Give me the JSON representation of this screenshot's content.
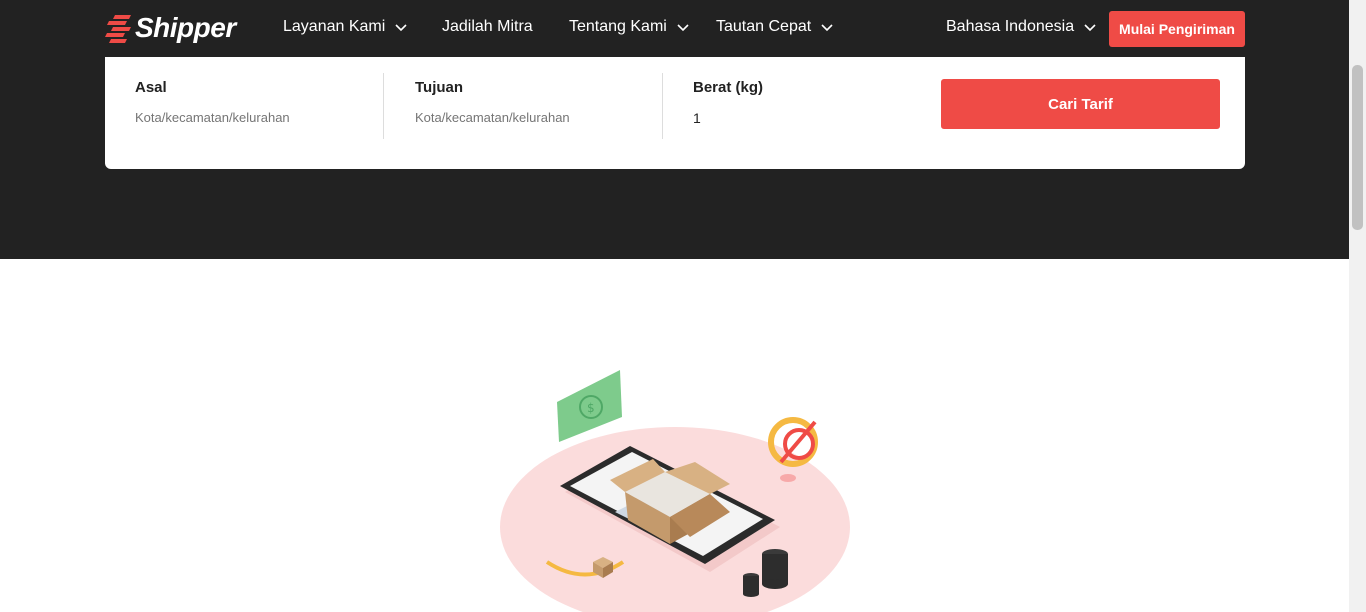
{
  "brand": {
    "name": "Shipper",
    "accent": "#ef4b46"
  },
  "nav": {
    "items": [
      {
        "label": "Layanan Kami",
        "has_dropdown": true
      },
      {
        "label": "Jadilah Mitra",
        "has_dropdown": false
      },
      {
        "label": "Tentang Kami",
        "has_dropdown": true
      },
      {
        "label": "Tautan Cepat",
        "has_dropdown": true
      }
    ],
    "language": "Bahasa Indonesia",
    "cta_label": "Mulai Pengiriman"
  },
  "rate_form": {
    "origin_label": "Asal",
    "origin_placeholder": "Kota/kecamatan/kelurahan",
    "destination_label": "Tujuan",
    "destination_placeholder": "Kota/kecamatan/kelurahan",
    "weight_label": "Berat (kg)",
    "weight_value": "1",
    "submit_label": "Cari Tarif"
  },
  "icons": [
    "chevron-down-icon",
    "shipper-logo-icon",
    "parcel-illustration"
  ]
}
